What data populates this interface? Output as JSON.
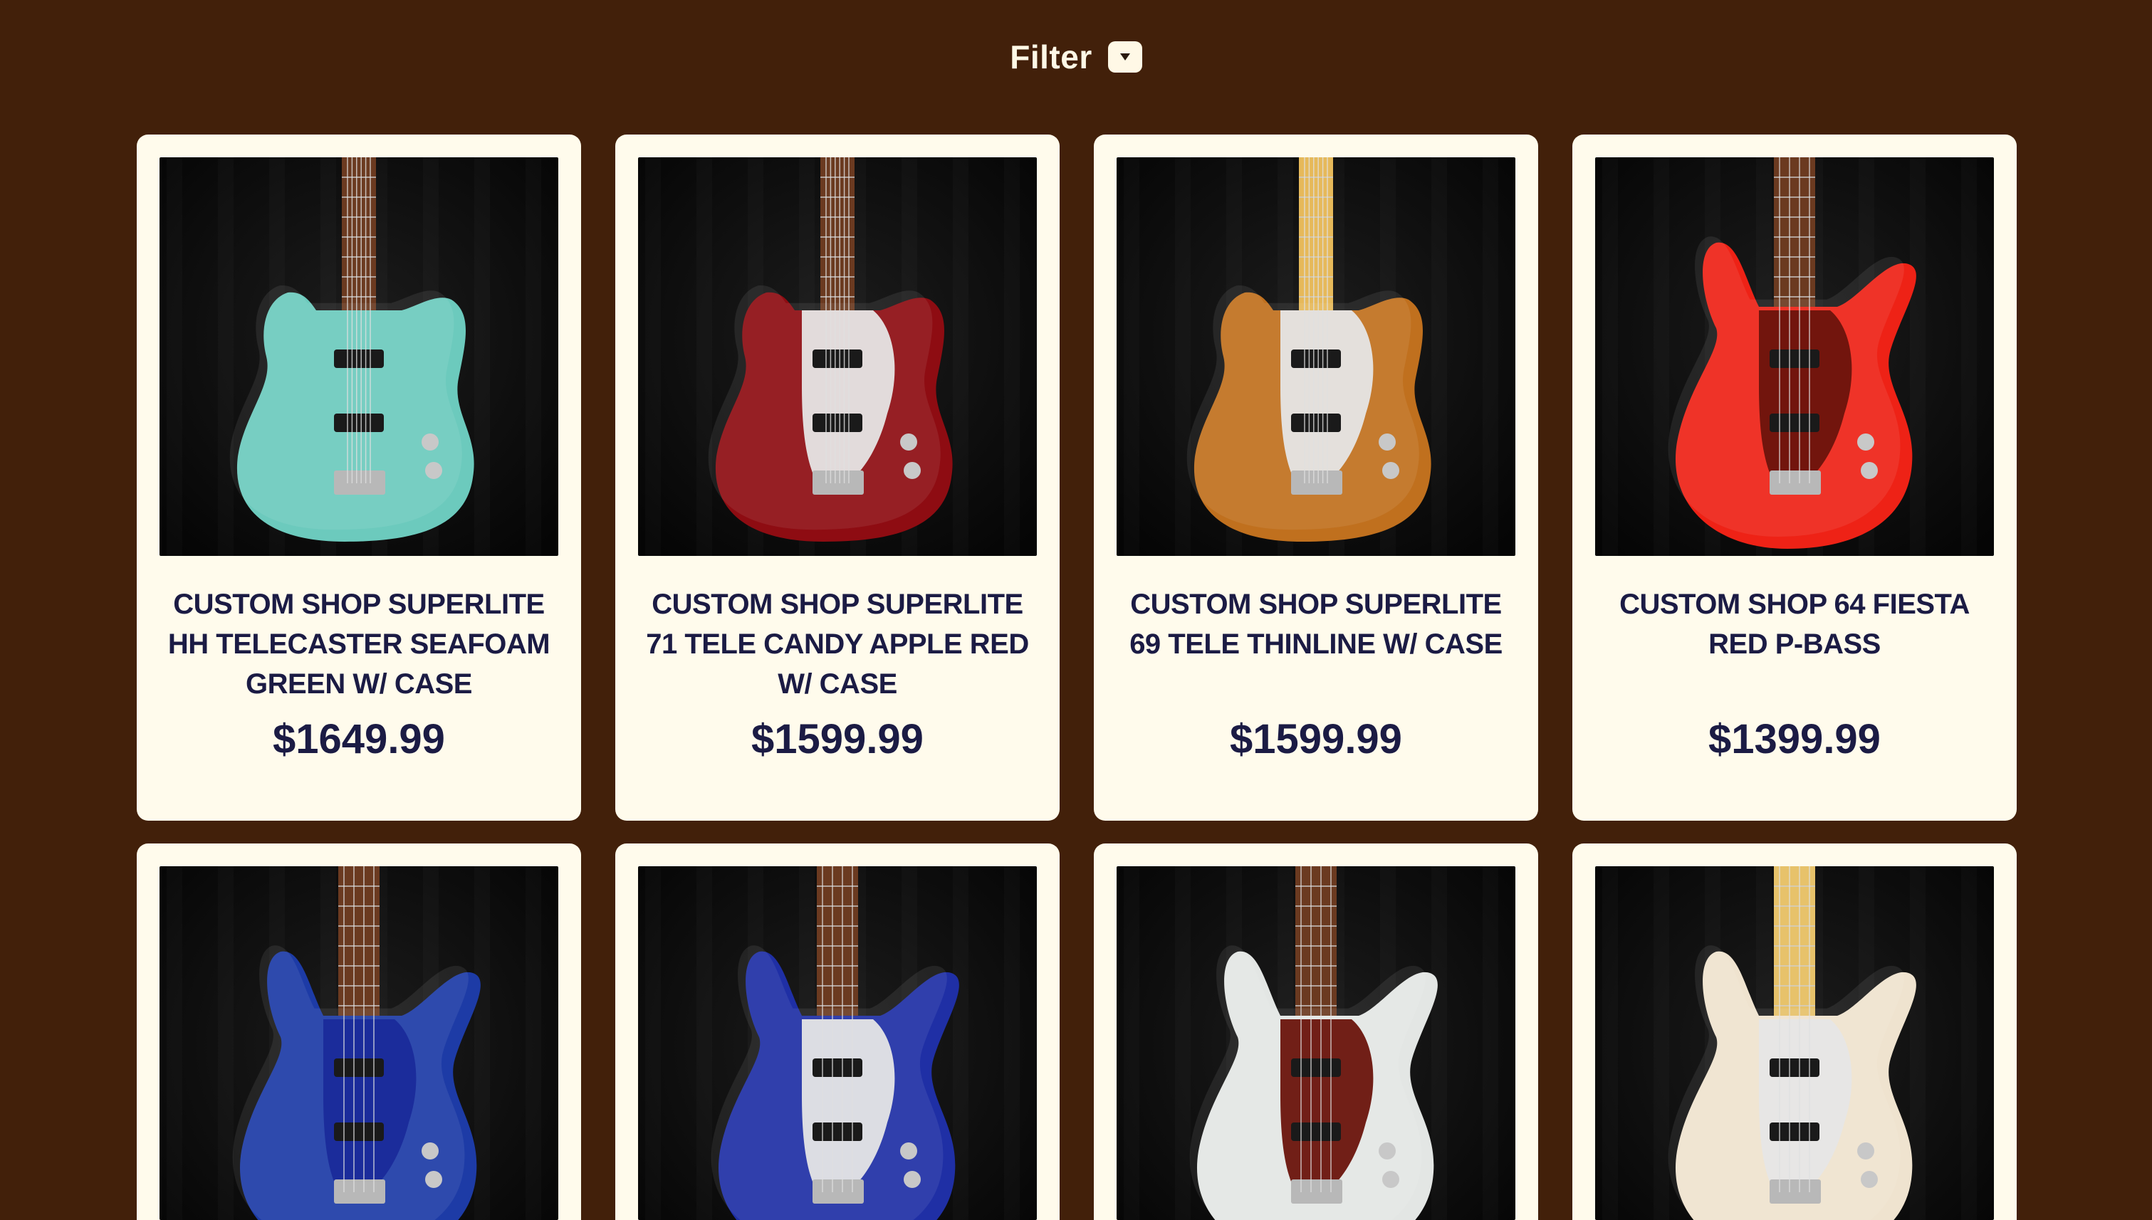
{
  "header": {
    "filter_label": "Filter",
    "filter_icon": "chevron-down-icon"
  },
  "colors": {
    "background": "#42200a",
    "card": "#fffbec",
    "text": "#1b1b44"
  },
  "products": [
    {
      "title": "CUSTOM SHOP SUPERLITE HH TELECASTER SEAFOAM GREEN W/ CASE",
      "price": "$1649.99",
      "body_color": "#6ccabd",
      "kind": "tele"
    },
    {
      "title": "CUSTOM SHOP SUPERLITE 71 TELE CANDY APPLE RED W/ CASE",
      "price": "$1599.99",
      "body_color": "#8e0c12",
      "kind": "tele"
    },
    {
      "title": "CUSTOM SHOP SUPERLITE 69 TELE THINLINE W/ CASE",
      "price": "$1599.99",
      "body_color": "#c0701e",
      "kind": "thinline"
    },
    {
      "title": "CUSTOM SHOP 64 FIESTA RED P-BASS",
      "price": "$1399.99",
      "body_color": "#ee2216",
      "kind": "pbass"
    },
    {
      "title": "",
      "price": "",
      "body_color": "#1d3ba6",
      "kind": "jbass"
    },
    {
      "title": "",
      "price": "",
      "body_color": "#1f2fa5",
      "kind": "jbass"
    },
    {
      "title": "",
      "price": "",
      "body_color": "#e3e6e4",
      "kind": "pbass"
    },
    {
      "title": "",
      "price": "",
      "body_color": "#efe3cf",
      "kind": "pbass"
    }
  ]
}
